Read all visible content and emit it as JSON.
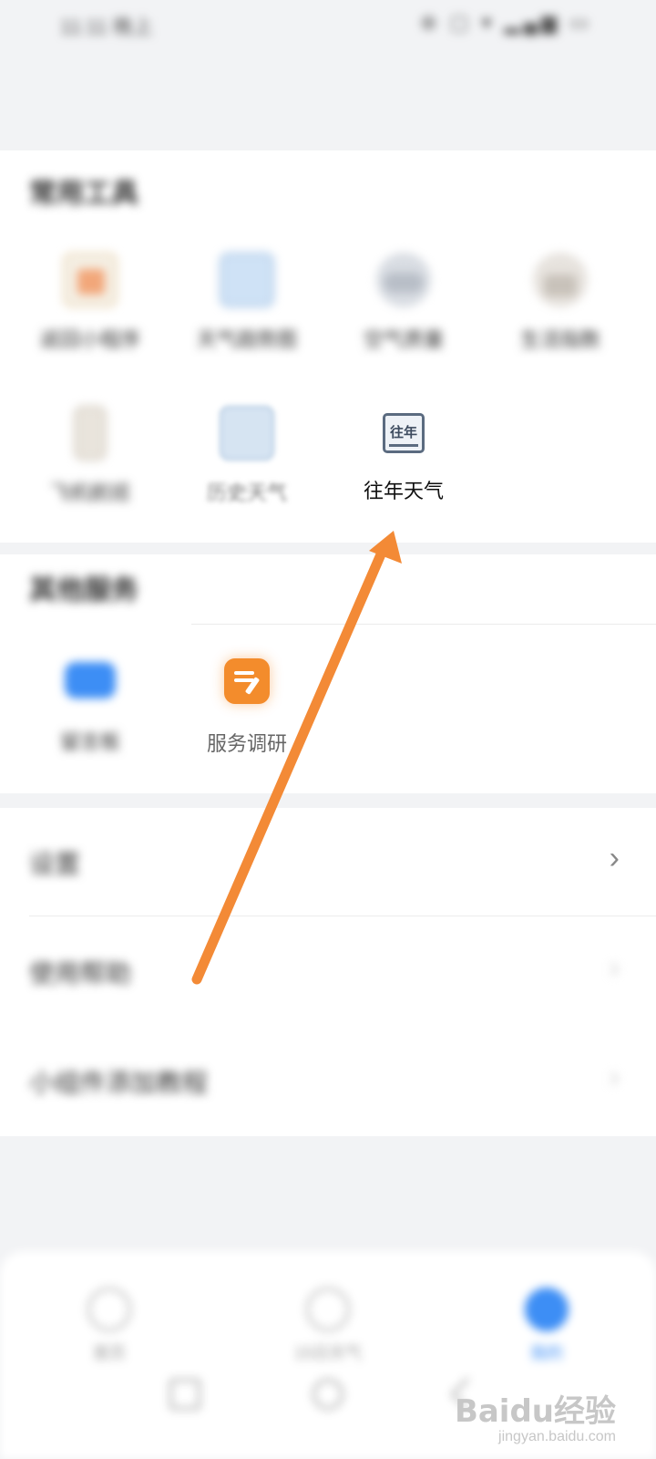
{
  "status_bar": {
    "time": "11:11 晚上",
    "icons": "⊕ ▢ ▾ ▂▄▆ ▭"
  },
  "tools": {
    "title": "常用工具",
    "items": [
      {
        "label": "返回小程序",
        "icon": "calendar-icon"
      },
      {
        "label": "天气趋势图",
        "icon": "chart-icon"
      },
      {
        "label": "空气质量",
        "icon": "cloudy-icon"
      },
      {
        "label": "生活指数",
        "icon": "house-icon"
      },
      {
        "label": "飞机航班",
        "icon": "bottle-icon"
      },
      {
        "label": "历史天气",
        "icon": "history-icon"
      },
      {
        "label": "往年天气",
        "icon_text": "往年",
        "icon": "past-year-icon"
      }
    ]
  },
  "services": {
    "title": "其他服务",
    "items": [
      {
        "label": "留言板",
        "icon": "message-icon"
      },
      {
        "label": "服务调研",
        "icon": "survey-icon"
      }
    ]
  },
  "settings_list": [
    {
      "label": "设置"
    },
    {
      "label": "使用帮助"
    },
    {
      "label": "小组件添加教程"
    }
  ],
  "bottom_nav": [
    {
      "label": "首页",
      "active": false
    },
    {
      "label": "15日天气",
      "active": false
    },
    {
      "label": "我的",
      "active": true
    }
  ],
  "watermark": {
    "brand": "Baidu经验",
    "url": "jingyan.baidu.com"
  },
  "colors": {
    "accent_blue": "#3d8ef5",
    "arrow_orange": "#f38a36",
    "survey_orange": "#f38c2c"
  }
}
